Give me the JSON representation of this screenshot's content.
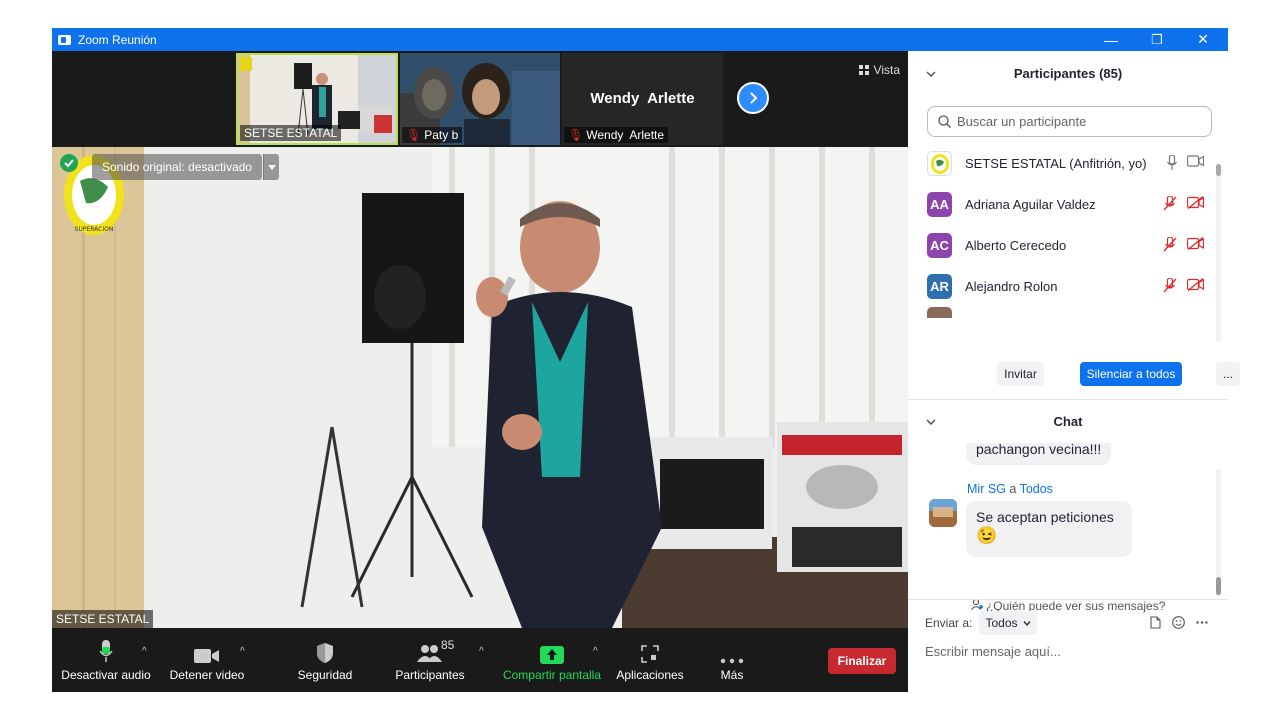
{
  "window": {
    "title": "Zoom Reunión",
    "minimize": "—",
    "restore": "❐",
    "close": "✕"
  },
  "strip": {
    "thumbs": [
      {
        "name": "SETSE ESTATAL"
      },
      {
        "name": "Paty b"
      },
      {
        "name": "Wendy  Arlette",
        "center_name": "Wendy  Arlette"
      }
    ],
    "view_label": "Vista"
  },
  "main_video": {
    "original_sound": "Sonido original: desactivado",
    "speaker_name": "SETSE ESTATAL",
    "logo_text": "SUPERACION"
  },
  "toolbar": {
    "audio": "Desactivar audio",
    "video": "Detener video",
    "security": "Seguridad",
    "participants": "Participantes",
    "participants_count": "85",
    "share": "Compartir pantalla",
    "apps": "Aplicaciones",
    "more": "Más",
    "end": "Finalizar"
  },
  "participants_panel": {
    "title": "Participantes (85)",
    "search_placeholder": "Buscar un participante",
    "rows": [
      {
        "initials": "",
        "name": "SETSE ESTATAL (Anfitrión, yo)",
        "color": "#ffffff"
      },
      {
        "initials": "AA",
        "name": "Adriana Aguilar Valdez",
        "color": "#8e44ad"
      },
      {
        "initials": "AC",
        "name": "Alberto Cerecedo",
        "color": "#8e44ad"
      },
      {
        "initials": "AR",
        "name": "Alejandro Rolon",
        "color": "#2e6fb0"
      }
    ],
    "invite": "Invitar",
    "mute_all": "Silenciar a todos",
    "more": "..."
  },
  "chat_panel": {
    "title": "Chat",
    "prev_message": "pachangon vecina!!!",
    "sender": "Mir SG",
    "to_word": "a",
    "recipient": "Todos",
    "message": "Se aceptan peticiones",
    "emoji": "😉",
    "who_can_see": "¿Quién puede ver sus mensajes?",
    "send_to_label": "Enviar a:",
    "send_to_value": "Todos",
    "input_placeholder": "Escribir mensaje aquí..."
  },
  "colors": {
    "zoom_blue": "#0e72ed",
    "end_red": "#c7292f",
    "share_green": "#23d959",
    "mute_red": "#e02828"
  }
}
